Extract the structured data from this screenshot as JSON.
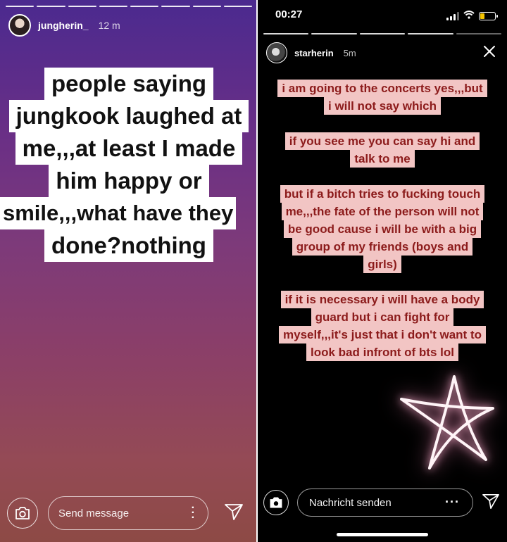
{
  "left_story": {
    "username": "jungherin_",
    "time": "12 m",
    "text_lines": [
      "people saying",
      "jungkook laughed at",
      "me,,,at least I made",
      "him happy or",
      "smile,,,what have they",
      "done?nothing"
    ],
    "message_placeholder": "Send message",
    "more_icon": "vertical-dots-icon",
    "send_icon": "paper-plane-icon",
    "camera_icon": "camera-icon"
  },
  "right_story": {
    "status": {
      "time": "00:27"
    },
    "username": "starherin",
    "time": "5m",
    "paragraphs": [
      [
        "i am going to the concerts yes,,,but",
        "i will not say which"
      ],
      [
        "if you see me you can say hi and",
        "talk to me"
      ],
      [
        "but if a bitch tries to fucking touch",
        "me,,,the fate of the person will not",
        "be good cause i will be with a big",
        "group of my friends (boys and",
        "girls)"
      ],
      [
        "if it is necessary i will have a body",
        "guard but i can fight for",
        "myself,,,it's just that i don't want to",
        "look bad infront of bts lol"
      ]
    ],
    "message_placeholder": "Nachricht senden",
    "more_icon": "horizontal-dots-icon",
    "send_icon": "paper-plane-icon",
    "camera_icon": "camera-icon",
    "close_icon": "close-icon",
    "sticker": "star-doodle"
  },
  "colors": {
    "highlight_bg": "#f2c5c4",
    "highlight_text": "#8c1b1b",
    "battery": "#f5c400"
  }
}
